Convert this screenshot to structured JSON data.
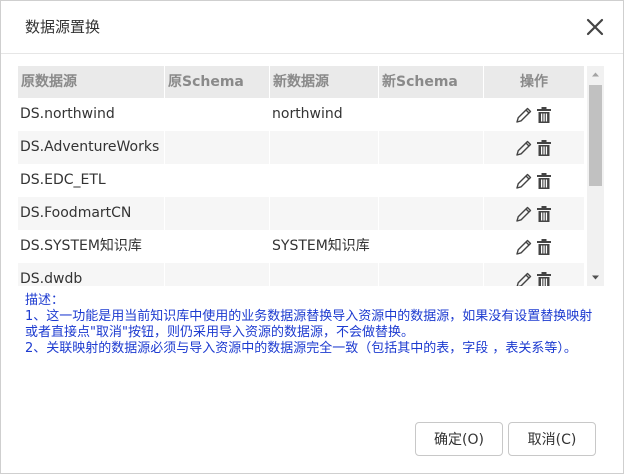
{
  "dialog": {
    "title": "数据源置换"
  },
  "table": {
    "headers": [
      "原数据源",
      "原Schema",
      "新数据源",
      "新Schema",
      "操作"
    ],
    "rows": [
      {
        "orig_ds": "DS.northwind",
        "orig_schema": "",
        "new_ds": "northwind",
        "new_schema": ""
      },
      {
        "orig_ds": "DS.AdventureWorks",
        "orig_schema": "",
        "new_ds": "",
        "new_schema": ""
      },
      {
        "orig_ds": "DS.EDC_ETL",
        "orig_schema": "",
        "new_ds": "",
        "new_schema": ""
      },
      {
        "orig_ds": "DS.FoodmartCN",
        "orig_schema": "",
        "new_ds": "",
        "new_schema": ""
      },
      {
        "orig_ds": "DS.SYSTEM知识库",
        "orig_schema": "",
        "new_ds": "SYSTEM知识库",
        "new_schema": ""
      },
      {
        "orig_ds": "DS.dwdb",
        "orig_schema": "",
        "new_ds": "",
        "new_schema": ""
      }
    ],
    "action_icons": [
      "pencil-icon",
      "trash-icon"
    ]
  },
  "description": {
    "heading": "描述：",
    "line1": "1、这一功能是用当前知识库中使用的业务数据源替换导入资源中的数据源，如果没有设置替换映射或者直接点\"取消\"按钮，则仍采用导入资源的数据源，不会做替换。",
    "line2": "2、关联映射的数据源必须与导入资源中的数据源完全一致（包括其中的表，字段 ，表关系等）。"
  },
  "buttons": {
    "ok": "确定(O)",
    "cancel": "取消(C)"
  },
  "colors": {
    "description_text": "#1d3bd0",
    "header_bg": "#eaeaea",
    "alt_row_bg": "#f6f6f6"
  }
}
